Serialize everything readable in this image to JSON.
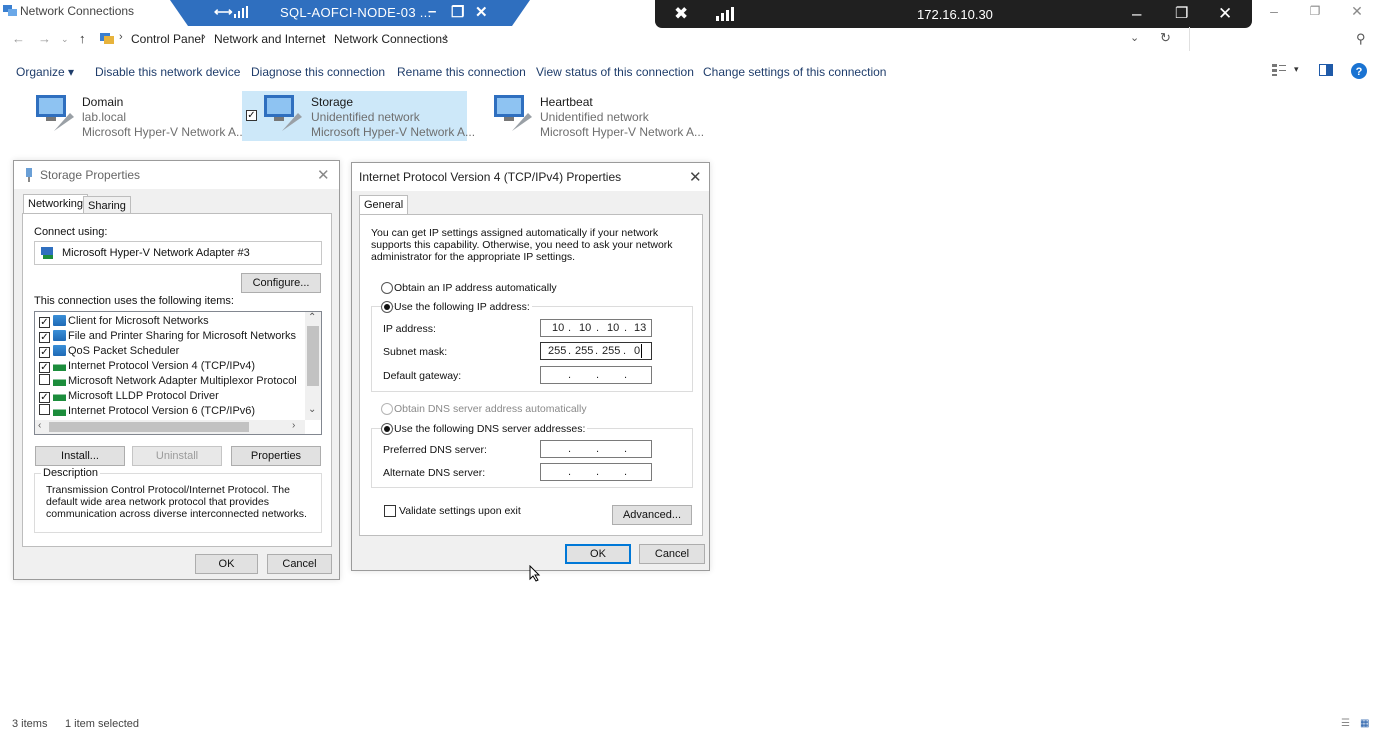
{
  "window": {
    "title": "Network Connections"
  },
  "rdp_bar": {
    "host": "SQL-AOFCI-NODE-03 ...",
    "minimize": "–",
    "restore": "❐",
    "close": "✕"
  },
  "remote_bar": {
    "ip": "172.16.10.30",
    "minimize": "–",
    "restore": "❐",
    "close": "✕"
  },
  "address_bar": {
    "crumbs": [
      "Control Panel",
      "Network and Internet",
      "Network Connections"
    ]
  },
  "command_bar": {
    "organize": "Organize",
    "items": [
      "Disable this network device",
      "Diagnose this connection",
      "Rename this connection",
      "View status of this connection",
      "Change settings of this connection"
    ]
  },
  "adapters": [
    {
      "name": "Domain",
      "status": "lab.local",
      "device": "Microsoft Hyper-V Network A..."
    },
    {
      "name": "Storage",
      "status": "Unidentified network",
      "device": "Microsoft Hyper-V Network A..."
    },
    {
      "name": "Heartbeat",
      "status": "Unidentified network",
      "device": "Microsoft Hyper-V Network A..."
    }
  ],
  "storage_props": {
    "title": "Storage Properties",
    "tabs": [
      "Networking",
      "Sharing"
    ],
    "connect_using_label": "Connect using:",
    "adapter": "Microsoft Hyper-V Network Adapter #3",
    "configure": "Configure...",
    "items_label": "This connection uses the following items:",
    "items": [
      {
        "label": "Client for Microsoft Networks",
        "checked": true
      },
      {
        "label": "File and Printer Sharing for Microsoft Networks",
        "checked": true
      },
      {
        "label": "QoS Packet Scheduler",
        "checked": true
      },
      {
        "label": "Internet Protocol Version 4 (TCP/IPv4)",
        "checked": true
      },
      {
        "label": "Microsoft Network Adapter Multiplexor Protocol",
        "checked": false
      },
      {
        "label": "Microsoft LLDP Protocol Driver",
        "checked": true
      },
      {
        "label": "Internet Protocol Version 6 (TCP/IPv6)",
        "checked": false
      }
    ],
    "install": "Install...",
    "uninstall": "Uninstall",
    "properties": "Properties",
    "description_label": "Description",
    "description": "Transmission Control Protocol/Internet Protocol. The default wide area network protocol that provides communication across diverse interconnected networks.",
    "ok": "OK",
    "cancel": "Cancel"
  },
  "ipv4_props": {
    "title": "Internet Protocol Version 4 (TCP/IPv4) Properties",
    "tab": "General",
    "intro": "You can get IP settings assigned automatically if your network supports this capability. Otherwise, you need to ask your network administrator for the appropriate IP settings.",
    "obtain_ip_auto": "Obtain an IP address automatically",
    "use_following_ip": "Use the following IP address:",
    "ip_label": "IP address:",
    "ip_value": [
      "10",
      "10",
      "10",
      "13"
    ],
    "subnet_label": "Subnet mask:",
    "subnet_value": [
      "255",
      "255",
      "255",
      "0"
    ],
    "gateway_label": "Default gateway:",
    "obtain_dns_auto": "Obtain DNS server address automatically",
    "use_following_dns": "Use the following DNS server addresses:",
    "preferred_dns_label": "Preferred DNS server:",
    "alternate_dns_label": "Alternate DNS server:",
    "validate": "Validate settings upon exit",
    "advanced": "Advanced...",
    "ok": "OK",
    "cancel": "Cancel"
  },
  "status_bar": {
    "count": "3 items",
    "selected": "1 item selected"
  },
  "colors": {
    "rdp_blue": "#2f6fbf",
    "dark_bar": "#202020",
    "selection": "#cde8f9",
    "focus_blue": "#0078d7"
  }
}
